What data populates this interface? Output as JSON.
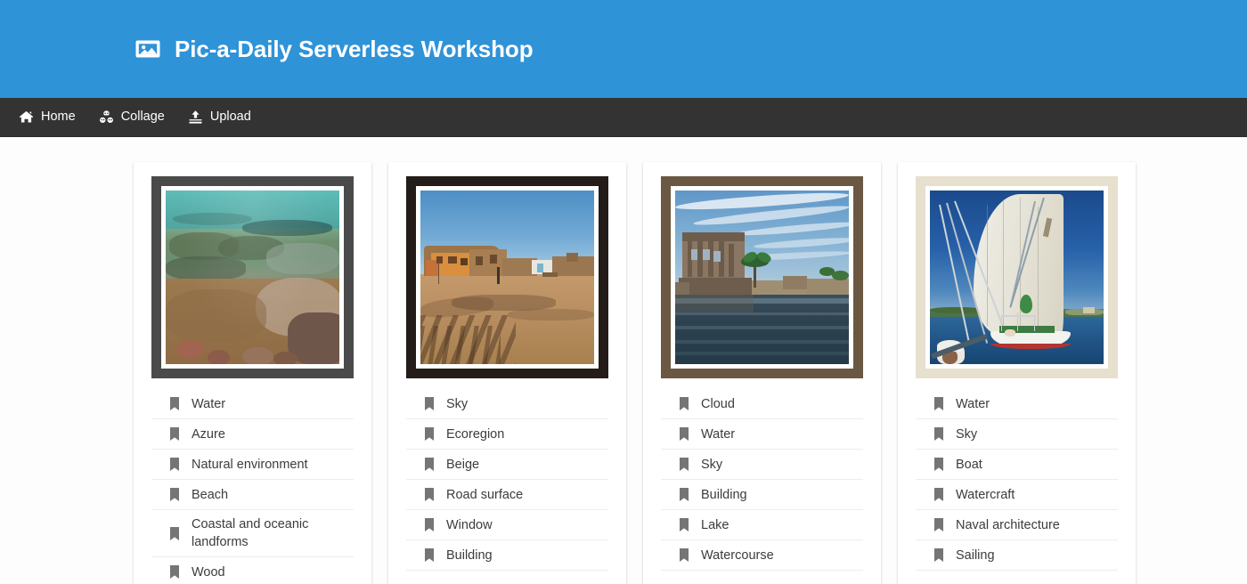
{
  "theme": {
    "header_bg": "#2f93d8",
    "nav_bg": "#333333",
    "page_bg": "#fdfdfd",
    "card_bg": "#ffffff",
    "text_color": "#3c3c3c",
    "icon_color": "#757575",
    "divider_color": "#ededed"
  },
  "header": {
    "title": "Pic-a-Daily Serverless Workshop",
    "logo_icon": "image-icon"
  },
  "nav": {
    "items": [
      {
        "label": "Home",
        "icon": "home-icon"
      },
      {
        "label": "Collage",
        "icon": "cubes-icon"
      },
      {
        "label": "Upload",
        "icon": "upload-icon"
      }
    ]
  },
  "gallery": {
    "cards": [
      {
        "name": "photo-card-shallow-water",
        "frame_color": "#4a4a4a",
        "labels": [
          {
            "icon": "bookmark-icon",
            "text": "Water"
          },
          {
            "icon": "bookmark-icon",
            "text": "Azure"
          },
          {
            "icon": "bookmark-icon",
            "text": "Natural environment"
          },
          {
            "icon": "bookmark-icon",
            "text": "Beach"
          },
          {
            "icon": "bookmark-icon",
            "text": "Coastal and oceanic landforms"
          },
          {
            "icon": "bookmark-icon",
            "text": "Wood"
          }
        ]
      },
      {
        "name": "photo-card-desert-village",
        "frame_color": "#231c18",
        "labels": [
          {
            "icon": "bookmark-icon",
            "text": "Sky"
          },
          {
            "icon": "bookmark-icon",
            "text": "Ecoregion"
          },
          {
            "icon": "bookmark-icon",
            "text": "Beige"
          },
          {
            "icon": "bookmark-icon",
            "text": "Road surface"
          },
          {
            "icon": "bookmark-icon",
            "text": "Window"
          },
          {
            "icon": "bookmark-icon",
            "text": "Building"
          }
        ]
      },
      {
        "name": "photo-card-temple-ruins",
        "frame_color": "#6b5843",
        "labels": [
          {
            "icon": "bookmark-icon",
            "text": "Cloud"
          },
          {
            "icon": "bookmark-icon",
            "text": "Water"
          },
          {
            "icon": "bookmark-icon",
            "text": "Sky"
          },
          {
            "icon": "bookmark-icon",
            "text": "Building"
          },
          {
            "icon": "bookmark-icon",
            "text": "Lake"
          },
          {
            "icon": "bookmark-icon",
            "text": "Watercourse"
          }
        ]
      },
      {
        "name": "photo-card-sailboat",
        "frame_color": "#e7e0cf",
        "labels": [
          {
            "icon": "bookmark-icon",
            "text": "Water"
          },
          {
            "icon": "bookmark-icon",
            "text": "Sky"
          },
          {
            "icon": "bookmark-icon",
            "text": "Boat"
          },
          {
            "icon": "bookmark-icon",
            "text": "Watercraft"
          },
          {
            "icon": "bookmark-icon",
            "text": "Naval architecture"
          },
          {
            "icon": "bookmark-icon",
            "text": "Sailing"
          }
        ]
      }
    ]
  }
}
